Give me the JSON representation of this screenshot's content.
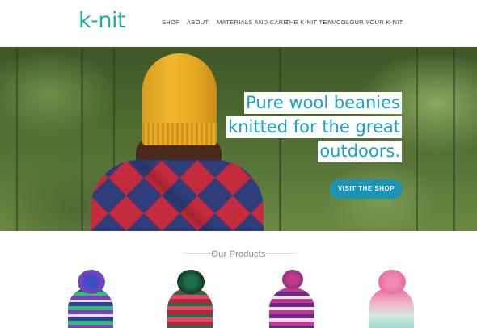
{
  "brand": {
    "logo": "k-nit",
    "accent": "#1fb0a4"
  },
  "nav": {
    "items": [
      {
        "label": "SHOP"
      },
      {
        "label": "ABOUT"
      },
      {
        "label": "MATERIALS AND CARE"
      },
      {
        "label": "THE K-NIT TEAM"
      },
      {
        "label": "COLOUR YOUR K-NIT"
      }
    ]
  },
  "hero": {
    "headline": [
      "Pure wool beanies",
      "knitted for the great",
      "outdoors."
    ],
    "headline_color": "#1aa0c8",
    "cta_label": "VISIT THE SHOP",
    "cta_color": "#1b93b5"
  },
  "products": {
    "title": "Our Products",
    "items": [
      {
        "name": "blue-green-fair-isle-beanie",
        "colors": [
          "#2a3fa0",
          "#33c06a",
          "#7b3fbf"
        ]
      },
      {
        "name": "red-green-pattern-beanie",
        "colors": [
          "#c0203a",
          "#1f6e4a",
          "#e04a62"
        ]
      },
      {
        "name": "pink-purple-fair-isle-beanie",
        "colors": [
          "#c23a8c",
          "#6b2a8a",
          "#e3e3ec"
        ]
      },
      {
        "name": "pink-white-gradient-beanie",
        "colors": [
          "#e66a9a",
          "#f0b6c8",
          "#9fd6c9"
        ]
      }
    ]
  }
}
